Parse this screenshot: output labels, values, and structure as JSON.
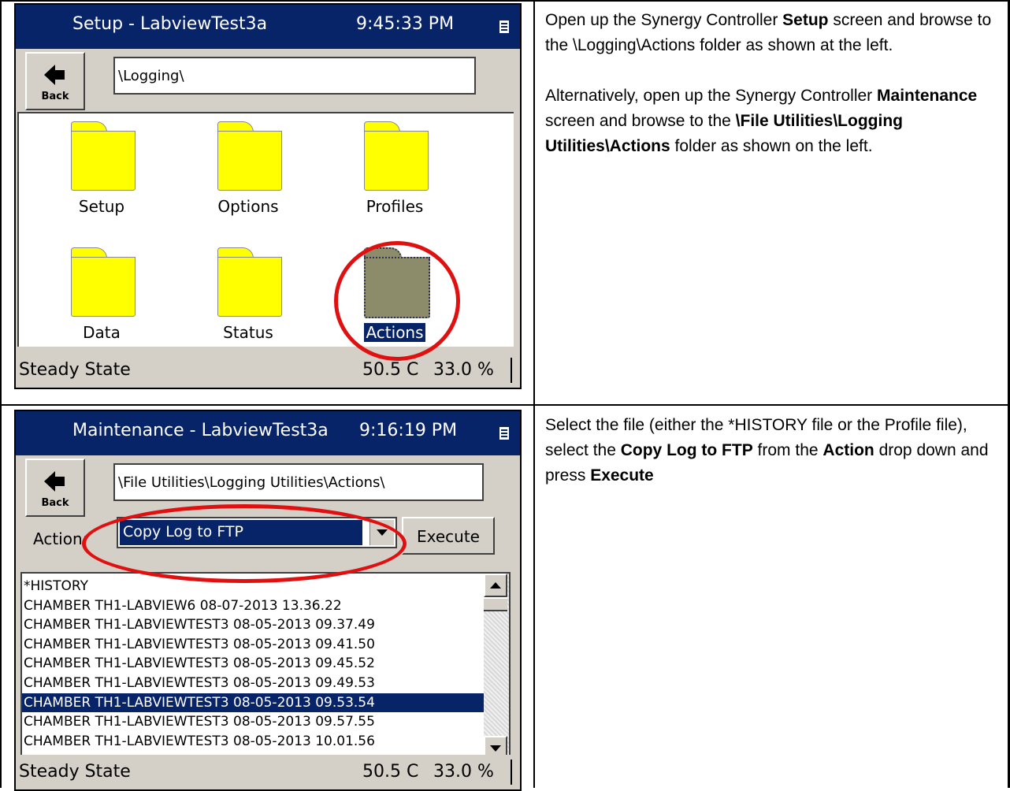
{
  "step1": {
    "title": "Setup - LabviewTest3a",
    "time": "9:45:33 PM",
    "back_label": "Back",
    "path": "\\Logging\\",
    "folders": [
      "Setup",
      "Options",
      "Profiles",
      "Data",
      "Status",
      "Actions"
    ],
    "selected_folder": "Actions",
    "status": "Steady State",
    "temperature": "50.5 C",
    "humidity": "33.0 %",
    "desc_p1_a": "Open up the Synergy Controller ",
    "desc_p1_b": "Setup",
    "desc_p1_c": " screen and browse to the \\Logging\\Actions folder as shown at the left.",
    "desc_p2_a": "Alternatively, open up the Synergy Controller ",
    "desc_p2_b": "Maintenance",
    "desc_p2_c": " screen and browse to the ",
    "desc_p2_d": "\\File Utilities\\Logging Utilities\\Actions",
    "desc_p2_e": " folder as shown on the left."
  },
  "step2": {
    "title": "Maintenance - LabviewTest3a",
    "time": "9:16:19 PM",
    "back_label": "Back",
    "path": "\\File Utilities\\Logging Utilities\\Actions\\",
    "action_label": "Action:",
    "action_value": "Copy Log to FTP",
    "execute_label": "Execute",
    "files": [
      "*HISTORY",
      "CHAMBER TH1-LABVIEW6 08-07-2013 13.36.22",
      "CHAMBER TH1-LABVIEWTEST3 08-05-2013 09.37.49",
      "CHAMBER TH1-LABVIEWTEST3 08-05-2013 09.41.50",
      "CHAMBER TH1-LABVIEWTEST3 08-05-2013 09.45.52",
      "CHAMBER TH1-LABVIEWTEST3 08-05-2013 09.49.53",
      "CHAMBER TH1-LABVIEWTEST3 08-05-2013 09.53.54",
      "CHAMBER TH1-LABVIEWTEST3 08-05-2013 09.57.55",
      "CHAMBER TH1-LABVIEWTEST3 08-05-2013 10.01.56"
    ],
    "selected_file": "CHAMBER TH1-LABVIEWTEST3 08-05-2013 09.53.54",
    "status": "Steady State",
    "temperature": "50.5 C",
    "humidity": "33.0 %",
    "desc_a": "Select the file (either the *HISTORY file or the Profile file), select the ",
    "desc_b": "Copy Log to FTP",
    "desc_c": " from the ",
    "desc_d": "Action",
    "desc_e": " drop down and press ",
    "desc_f": "Execute"
  },
  "colors": {
    "titlebar": "#082468",
    "folder": "#ffff00",
    "highlight_circle": "#e01010",
    "panel": "#d4d0c8"
  }
}
